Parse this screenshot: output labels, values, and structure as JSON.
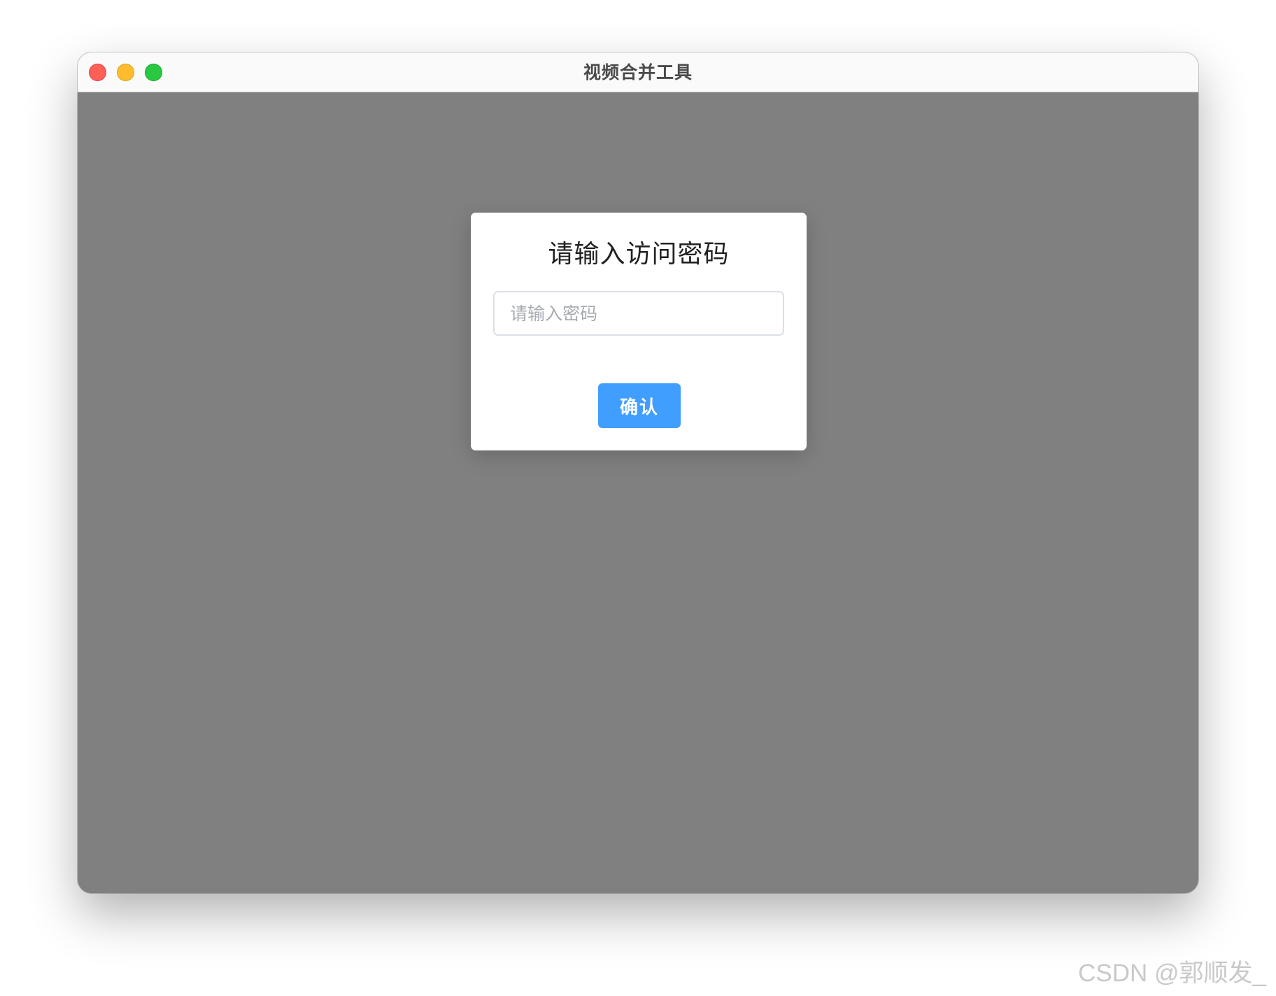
{
  "window": {
    "title": "视频合并工具"
  },
  "dialog": {
    "title": "请输入访问密码",
    "password_placeholder": "请输入密码",
    "password_value": "",
    "confirm_label": "确认"
  },
  "watermark": "CSDN @郭顺发_",
  "colors": {
    "overlay": "#808080",
    "primary_button": "#409eff",
    "close": "#fe5f57",
    "minimize": "#febc2e",
    "maximize": "#28c840"
  }
}
